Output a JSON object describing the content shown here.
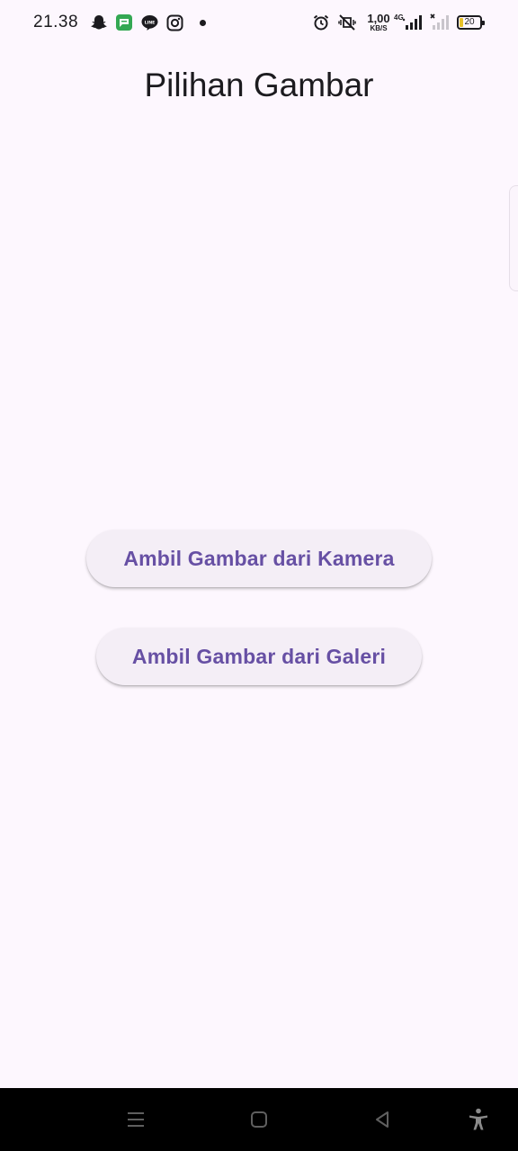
{
  "status_bar": {
    "time": "21.38",
    "notification_icons": [
      "snapchat-icon",
      "messages-icon",
      "line-icon",
      "instagram-icon",
      "more-notifications-dot"
    ],
    "net_speed_value": "1,00",
    "net_speed_unit": "KB/S",
    "network_type": "4G",
    "battery_level": "20",
    "colors": {
      "battery_fill": "#e8c229",
      "messages_green": "#34a853"
    }
  },
  "app_bar": {
    "title": "Pilihan Gambar"
  },
  "actions": {
    "camera_button": "Ambil Gambar dari Kamera",
    "gallery_button": "Ambil Gambar dari Galeri"
  },
  "theme": {
    "background": "#fdf7fe",
    "button_background": "#f4eef6",
    "button_text": "#6750a4",
    "title_text": "#1c1b1f"
  },
  "nav_bar": {
    "items": [
      "menu-icon",
      "home-icon",
      "back-icon",
      "accessibility-icon"
    ]
  }
}
